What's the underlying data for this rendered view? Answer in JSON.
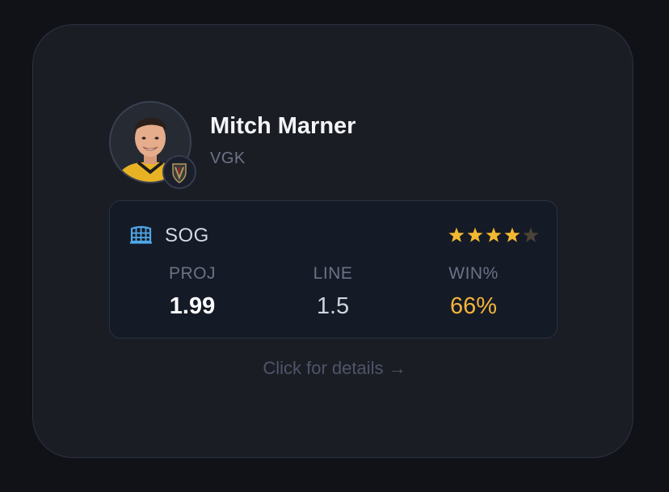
{
  "player": {
    "name": "Mitch Marner",
    "team": "VGK"
  },
  "prop": {
    "market": "SOG",
    "market_icon": "hockey-net-icon",
    "rating": 4,
    "rating_max": 5,
    "stats": [
      {
        "label": "PROJ",
        "value": "1.99"
      },
      {
        "label": "LINE",
        "value": "1.5"
      },
      {
        "label": "WIN%",
        "value": "66%"
      }
    ]
  },
  "details_link": "Click for details →",
  "colors": {
    "card_bg": "#1b1d25",
    "accent_gold": "#f3b43a",
    "star_filled": "#f4b731",
    "star_empty": "#4a4436",
    "net_icon": "#4fa8e8"
  }
}
